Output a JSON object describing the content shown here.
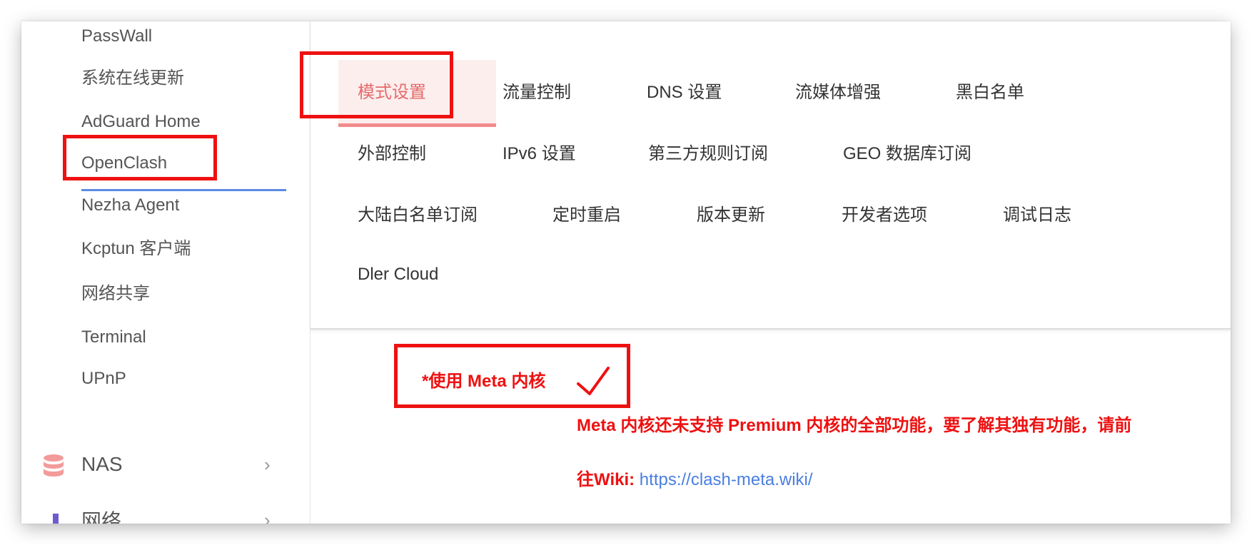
{
  "sidebar": {
    "items": [
      {
        "label": "PassWall"
      },
      {
        "label": "系统在线更新"
      },
      {
        "label": "AdGuard Home"
      },
      {
        "label": "OpenClash"
      },
      {
        "label": "Nezha Agent"
      },
      {
        "label": "Kcptun 客户端"
      },
      {
        "label": "网络共享"
      },
      {
        "label": "Terminal"
      },
      {
        "label": "UPnP"
      }
    ],
    "groups": [
      {
        "label": "NAS",
        "icon": "database-icon"
      },
      {
        "label": "网络",
        "icon": "network-icon"
      }
    ],
    "active_item": "OpenClash"
  },
  "tabs": [
    {
      "label": "模式设置"
    },
    {
      "label": "流量控制"
    },
    {
      "label": "DNS 设置"
    },
    {
      "label": "流媒体增强"
    },
    {
      "label": "黑白名单"
    },
    {
      "label": "外部控制"
    },
    {
      "label": "IPv6 设置"
    },
    {
      "label": "第三方规则订阅"
    },
    {
      "label": "GEO 数据库订阅"
    },
    {
      "label": "大陆白名单订阅"
    },
    {
      "label": "定时重启"
    },
    {
      "label": "版本更新"
    },
    {
      "label": "开发者选项"
    },
    {
      "label": "调试日志"
    },
    {
      "label": "Dler Cloud"
    }
  ],
  "active_tab": "模式设置",
  "option": {
    "label": "*使用 Meta 内核",
    "checked": true
  },
  "note": {
    "line1": "Meta 内核还未支持 Premium 内核的全部功能，要了解其独有功能，请前",
    "line2_prefix": "往Wiki: ",
    "link": "https://clash-meta.wiki/"
  },
  "colors": {
    "accent_red": "#ee1111",
    "active_tab_text": "#e56a6a",
    "link": "#4a7ee0",
    "sidebar_underline": "#5b8ae6"
  }
}
